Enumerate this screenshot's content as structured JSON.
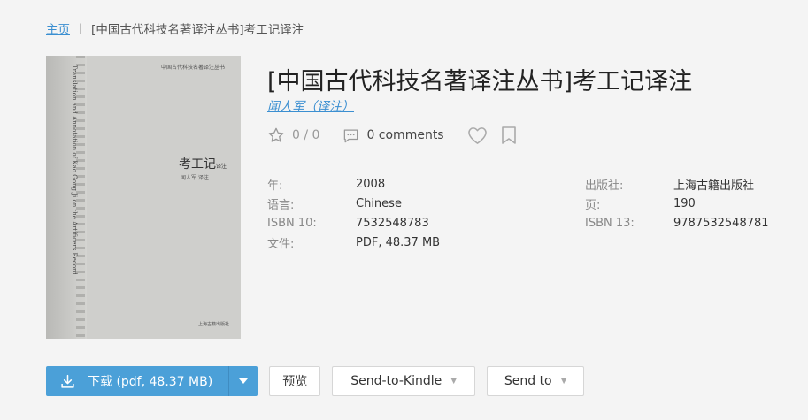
{
  "breadcrumb": {
    "home": "主页",
    "separator": "|",
    "current": "[中国古代科技名著译注丛书]考工记译注"
  },
  "book": {
    "title": "[中国古代科技名著译注丛书]考工记译注",
    "author": "闻人军（译注）",
    "cover": {
      "series": "中国古代科技名著译注丛书",
      "english_title": "Translation and Annotation of Kao Gong Ji on the Artificers Record",
      "chinese_title": "考工记",
      "chinese_title_suffix": "译注",
      "author_line": "闻人军 译注",
      "publisher": "上海古籍出版社"
    }
  },
  "stats": {
    "rating": "0 / 0",
    "comments": "0 comments"
  },
  "properties": {
    "left": [
      {
        "label": "年:",
        "value": "2008"
      },
      {
        "label": "语言:",
        "value": "Chinese"
      },
      {
        "label": "ISBN 10:",
        "value": "7532548783"
      },
      {
        "label": "文件:",
        "value": "PDF, 48.37 MB"
      }
    ],
    "right": [
      {
        "label": "出版社:",
        "value": "上海古籍出版社"
      },
      {
        "label": "页:",
        "value": "190"
      },
      {
        "label": "ISBN 13:",
        "value": "9787532548781"
      }
    ]
  },
  "actions": {
    "download": "下载 (pdf, 48.37 MB)",
    "preview": "预览",
    "send_to_kindle": "Send-to-Kindle",
    "send_to": "Send to"
  },
  "icons": {
    "download": "download-icon",
    "star": "star-icon",
    "comment": "comment-icon",
    "heart": "heart-icon",
    "bookmark": "bookmark-icon",
    "caret": "caret-down-icon"
  },
  "colors": {
    "link": "#3b8fd1",
    "primary_button": "#4ba0d8",
    "background": "#f4f4f4"
  }
}
